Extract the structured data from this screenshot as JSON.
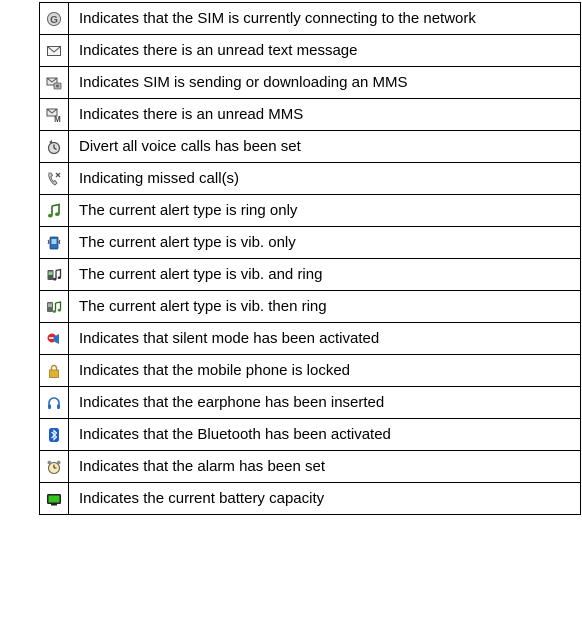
{
  "rows": [
    {
      "icon": "network-connecting-icon",
      "text": "Indicates that the SIM is currently connecting to the network"
    },
    {
      "icon": "unread-message-icon",
      "text": "Indicates there is an unread text message"
    },
    {
      "icon": "mms-sending-icon",
      "text": "Indicates SIM is sending or downloading an MMS"
    },
    {
      "icon": "unread-mms-icon",
      "text": "Indicates there is an unread MMS"
    },
    {
      "icon": "divert-calls-icon",
      "text": "Divert all voice calls has been set"
    },
    {
      "icon": "missed-call-icon",
      "text": "Indicating missed call(s)"
    },
    {
      "icon": "ring-only-icon",
      "text": "The current alert type is ring only"
    },
    {
      "icon": "vibrate-only-icon",
      "text": "The current alert type is vib. only"
    },
    {
      "icon": "vibrate-and-ring-icon",
      "text": "The current alert type is vib. and ring"
    },
    {
      "icon": "vibrate-then-ring-icon",
      "text": "The current alert type is vib. then ring"
    },
    {
      "icon": "silent-mode-icon",
      "text": "Indicates that silent mode has been activated"
    },
    {
      "icon": "phone-locked-icon",
      "text": "Indicates that the mobile phone is locked"
    },
    {
      "icon": "earphone-icon",
      "text": "Indicates that the earphone has been inserted"
    },
    {
      "icon": "bluetooth-icon",
      "text": "Indicates that the Bluetooth has been activated"
    },
    {
      "icon": "alarm-icon",
      "text": "Indicates that the alarm has been set"
    },
    {
      "icon": "battery-icon",
      "text": "Indicates the current battery capacity"
    }
  ]
}
